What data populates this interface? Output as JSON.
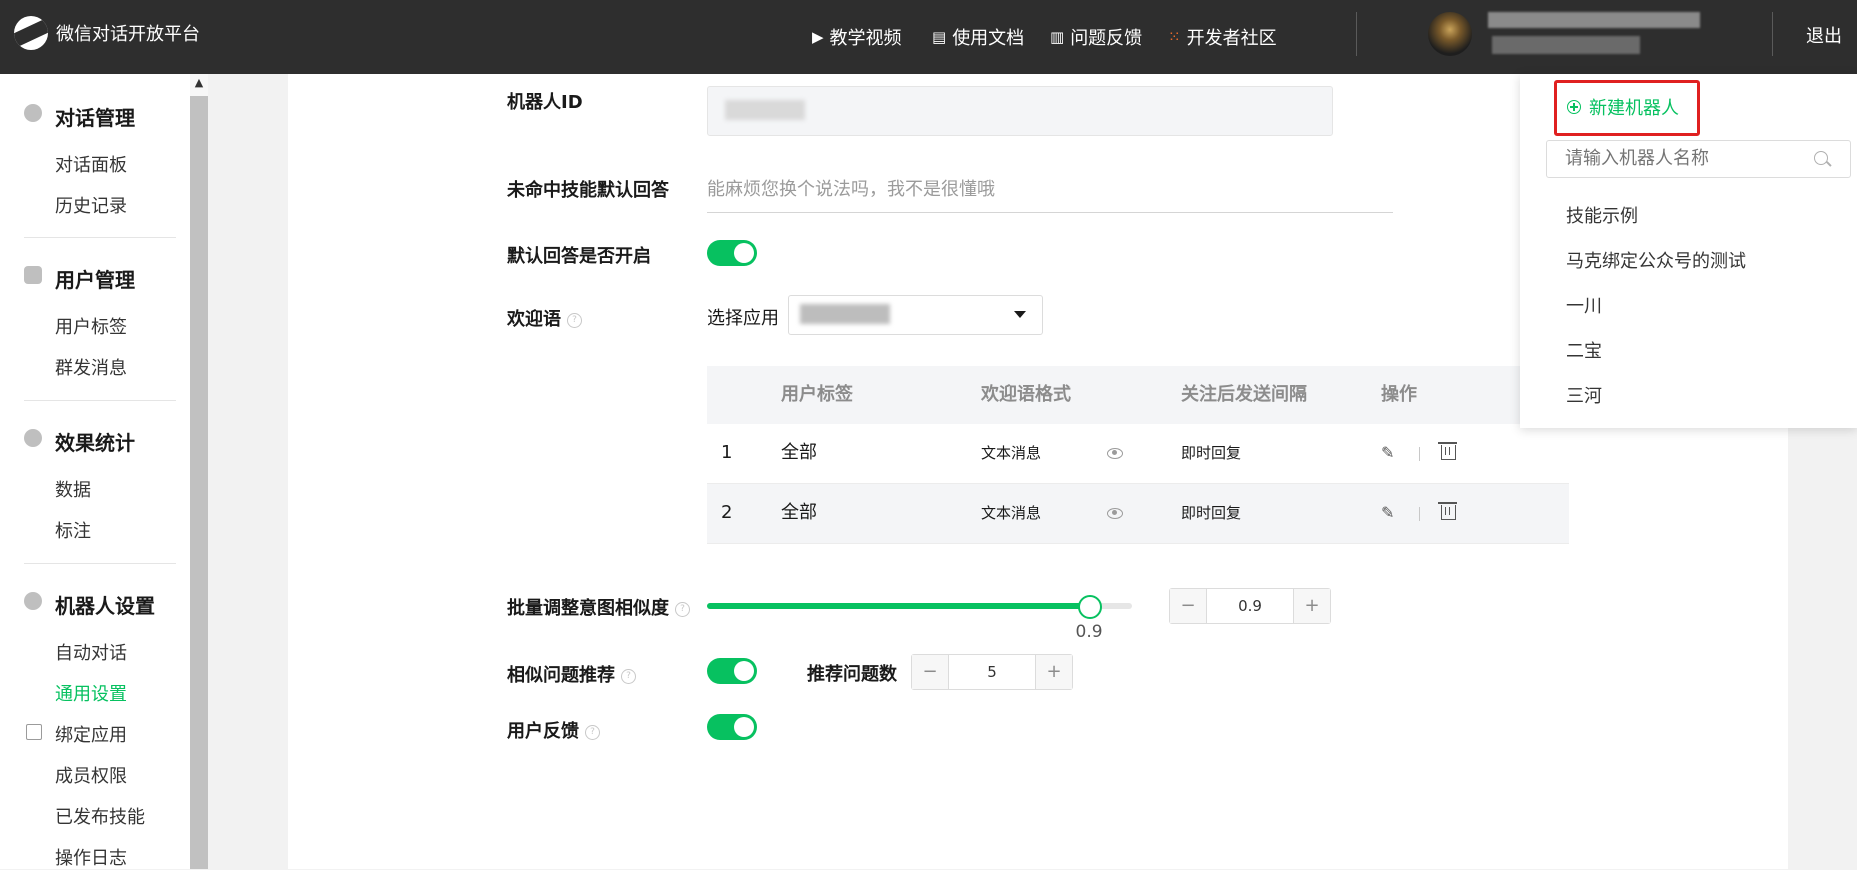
{
  "header": {
    "app_title": "微信对话开放平台",
    "nav": [
      "教学视频",
      "使用文档",
      "问题反馈",
      "开发者社区"
    ],
    "logout": "退出"
  },
  "sidebar": {
    "sections": [
      {
        "title": "对话管理",
        "items": [
          "对话面板",
          "历史记录"
        ]
      },
      {
        "title": "用户管理",
        "items": [
          "用户标签",
          "群发消息"
        ]
      },
      {
        "title": "效果统计",
        "items": [
          "数据",
          "标注"
        ]
      },
      {
        "title": "机器人设置",
        "items": [
          "自动对话",
          "通用设置",
          "绑定应用",
          "成员权限",
          "已发布技能",
          "操作日志"
        ]
      }
    ],
    "active_item": "通用设置"
  },
  "form": {
    "robot_id_label": "机器人ID",
    "default_answer_label": "未命中技能默认回答",
    "default_answer_placeholder": "能麻烦您换个说法吗，我不是很懂哦",
    "default_answer_enabled_label": "默认回答是否开启",
    "default_answer_enabled": true,
    "welcome_label": "欢迎语",
    "select_app_label": "选择应用",
    "welcome_table": {
      "headers": [
        "",
        "用户标签",
        "欢迎语格式",
        "关注后发送间隔",
        "操作"
      ],
      "rows": [
        {
          "index": "1",
          "tag": "全部",
          "format": "文本消息",
          "interval": "即时回复"
        },
        {
          "index": "2",
          "tag": "全部",
          "format": "文本消息",
          "interval": "即时回复"
        }
      ]
    },
    "similarity_label": "批量调整意图相似度",
    "similarity_value": "0.9",
    "similarity_level": 0.9,
    "similar_question_label": "相似问题推荐",
    "similar_question_enabled": true,
    "recommend_count_label": "推荐问题数",
    "recommend_count_value": "5",
    "user_feedback_label": "用户反馈",
    "user_feedback_enabled": true,
    "stepper_minus": "−",
    "stepper_plus": "+"
  },
  "robot_dropdown": {
    "new_robot": "新建机器人",
    "search_placeholder": "请输入机器人名称",
    "robots": [
      "技能示例",
      "马克绑定公众号的测试",
      "一川",
      "二宝",
      "三河"
    ]
  },
  "colors": {
    "accent": "#07c160",
    "topbar": "#2e2e2e",
    "highlight": "#e02020"
  }
}
